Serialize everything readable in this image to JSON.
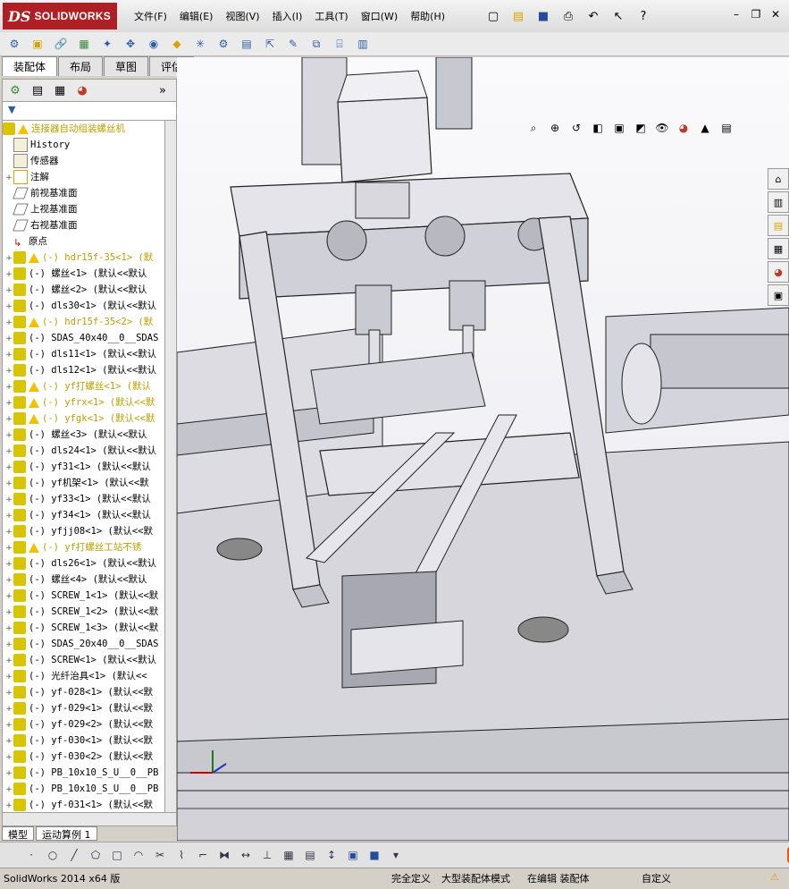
{
  "app": {
    "brand_ds": "DS",
    "brand_name": "SOLIDWORKS"
  },
  "menu": [
    "文件(F)",
    "编辑(E)",
    "视图(V)",
    "插入(I)",
    "工具(T)",
    "窗口(W)",
    "帮助(H)"
  ],
  "tabs": [
    "装配体",
    "布局",
    "草图",
    "评估"
  ],
  "tree": {
    "root": "连接器自动组装螺丝机",
    "items": [
      {
        "label": "History",
        "warn": false,
        "kind": "folder",
        "expand": false
      },
      {
        "label": "传感器",
        "warn": false,
        "kind": "folder",
        "expand": false
      },
      {
        "label": "注解",
        "warn": false,
        "kind": "annot",
        "expand": true
      },
      {
        "label": "前视基准面",
        "warn": false,
        "kind": "plane",
        "expand": false
      },
      {
        "label": "上视基准面",
        "warn": false,
        "kind": "plane",
        "expand": false
      },
      {
        "label": "右视基准面",
        "warn": false,
        "kind": "plane",
        "expand": false
      },
      {
        "label": "原点",
        "warn": false,
        "kind": "origin",
        "expand": false
      },
      {
        "label": "(-) hdr15f-35<1> (默",
        "warn": true,
        "kind": "part",
        "expand": true
      },
      {
        "label": "(-) 螺丝<1> (默认<<默认",
        "warn": false,
        "kind": "part",
        "expand": true
      },
      {
        "label": "(-) 螺丝<2> (默认<<默认",
        "warn": false,
        "kind": "part",
        "expand": true
      },
      {
        "label": "(-) dls30<1> (默认<<默认",
        "warn": false,
        "kind": "part",
        "expand": true
      },
      {
        "label": "(-) hdr15f-35<2> (默",
        "warn": true,
        "kind": "part",
        "expand": true
      },
      {
        "label": "(-) SDAS_40x40__0__SDAS",
        "warn": false,
        "kind": "part",
        "expand": true
      },
      {
        "label": "(-) dls11<1> (默认<<默认",
        "warn": false,
        "kind": "part",
        "expand": true
      },
      {
        "label": "(-) dls12<1> (默认<<默认",
        "warn": false,
        "kind": "part",
        "expand": true
      },
      {
        "label": "(-) yf打螺丝<1> (默认",
        "warn": true,
        "kind": "part",
        "expand": true
      },
      {
        "label": "(-) yfrx<1> (默认<<默",
        "warn": true,
        "kind": "part",
        "expand": true
      },
      {
        "label": "(-) yfgk<1> (默认<<默",
        "warn": true,
        "kind": "part",
        "expand": true
      },
      {
        "label": "(-) 螺丝<3> (默认<<默认",
        "warn": false,
        "kind": "part",
        "expand": true
      },
      {
        "label": "(-) dls24<1> (默认<<默认",
        "warn": false,
        "kind": "part",
        "expand": true
      },
      {
        "label": "(-) yf31<1> (默认<<默认",
        "warn": false,
        "kind": "part",
        "expand": true
      },
      {
        "label": "(-) yf机架<1> (默认<<默",
        "warn": false,
        "kind": "part",
        "expand": true
      },
      {
        "label": "(-) yf33<1> (默认<<默认",
        "warn": false,
        "kind": "part",
        "expand": true
      },
      {
        "label": "(-) yf34<1> (默认<<默认",
        "warn": false,
        "kind": "part",
        "expand": true
      },
      {
        "label": "(-) yfjj08<1> (默认<<默",
        "warn": false,
        "kind": "part",
        "expand": true
      },
      {
        "label": "(-) yf打螺丝工站不锈",
        "warn": true,
        "kind": "part",
        "expand": true
      },
      {
        "label": "(-) dls26<1> (默认<<默认",
        "warn": false,
        "kind": "part",
        "expand": true
      },
      {
        "label": "(-) 螺丝<4> (默认<<默认",
        "warn": false,
        "kind": "part",
        "expand": true
      },
      {
        "label": "(-) SCREW_1<1> (默认<<默",
        "warn": false,
        "kind": "part",
        "expand": true
      },
      {
        "label": "(-) SCREW_1<2> (默认<<默",
        "warn": false,
        "kind": "part",
        "expand": true
      },
      {
        "label": "(-) SCREW_1<3> (默认<<默",
        "warn": false,
        "kind": "part",
        "expand": true
      },
      {
        "label": "(-) SDAS_20x40__0__SDAS",
        "warn": false,
        "kind": "part",
        "expand": true
      },
      {
        "label": "(-) SCREW<1> (默认<<默认",
        "warn": false,
        "kind": "part",
        "expand": true
      },
      {
        "label": "(-) 光纤治具<1> (默认<<",
        "warn": false,
        "kind": "part",
        "expand": true
      },
      {
        "label": "(-) yf-028<1> (默认<<默",
        "warn": false,
        "kind": "part",
        "expand": true
      },
      {
        "label": "(-) yf-029<1> (默认<<默",
        "warn": false,
        "kind": "part",
        "expand": true
      },
      {
        "label": "(-) yf-029<2> (默认<<默",
        "warn": false,
        "kind": "part",
        "expand": true
      },
      {
        "label": "(-) yf-030<1> (默认<<默",
        "warn": false,
        "kind": "part",
        "expand": true
      },
      {
        "label": "(-) yf-030<2> (默认<<默",
        "warn": false,
        "kind": "part",
        "expand": true
      },
      {
        "label": "(-) PB_10x10_S_U__0__PB",
        "warn": false,
        "kind": "part",
        "expand": true
      },
      {
        "label": "(-) PB_10x10_S_U__0__PB",
        "warn": false,
        "kind": "part",
        "expand": true
      },
      {
        "label": "(-) yf-031<1> (默认<<默",
        "warn": false,
        "kind": "part",
        "expand": true
      }
    ]
  },
  "bottom_tabs": [
    "模型",
    "运动算例 1"
  ],
  "status": {
    "version": "SolidWorks 2014 x64 版",
    "constraint": "完全定义",
    "mode": "大型装配体模式",
    "editing": "在编辑 装配体",
    "custom": "自定义"
  },
  "colors": {
    "brand": "#b01f24",
    "warn": "#f2c200",
    "part": "#d9c400"
  }
}
